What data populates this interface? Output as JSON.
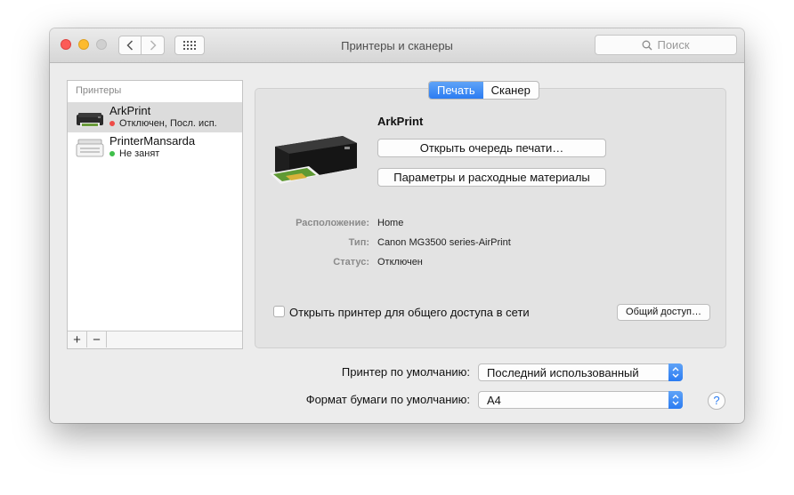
{
  "window": {
    "title": "Принтеры и сканеры",
    "search_placeholder": "Поиск"
  },
  "sidebar": {
    "header": "Принтеры",
    "printers": [
      {
        "name": "ArkPrint",
        "status": "Отключен, Посл. исп.",
        "status_color": "#ee4b47"
      },
      {
        "name": "PrinterMansarda",
        "status": "Не занят",
        "status_color": "#3fbf4a"
      }
    ],
    "add_label": "+",
    "remove_label": "−"
  },
  "tabs": [
    {
      "label": "Печать",
      "active": true
    },
    {
      "label": "Сканер",
      "active": false
    }
  ],
  "detail": {
    "printer_name": "ArkPrint",
    "open_queue_button": "Открыть очередь печати…",
    "options_button": "Параметры и расходные материалы",
    "info": [
      {
        "label": "Расположение:",
        "value": "Home"
      },
      {
        "label": "Тип:",
        "value": "Canon MG3500 series-AirPrint"
      },
      {
        "label": "Статус:",
        "value": "Отключен"
      }
    ],
    "share_label": "Открыть принтер для общего доступа в сети",
    "share_checked": false,
    "sharing_button": "Общий доступ…"
  },
  "defaults": {
    "printer_label": "Принтер по умолчанию:",
    "printer_value": "Последний использованный",
    "paper_label": "Формат бумаги по умолчанию:",
    "paper_value": "A4"
  },
  "help_label": "?",
  "colors": {
    "accent": "#2b7cf2"
  }
}
